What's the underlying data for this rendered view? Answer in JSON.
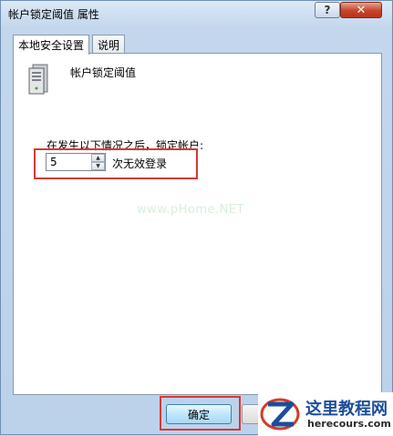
{
  "window": {
    "title": "帐户锁定阈值 属性",
    "help_label": "?",
    "close_label": "✕"
  },
  "tabs": [
    {
      "label": "本地安全设置",
      "active": true
    },
    {
      "label": "说明",
      "active": false
    }
  ],
  "policy": {
    "icon": "server-icon",
    "name": "帐户锁定阈值"
  },
  "lockout": {
    "label": "在发生以下情况之后，锁定帐户:",
    "value": "5",
    "unit_label": "次无效登录"
  },
  "watermark": "www.pHome.NET",
  "buttons": {
    "ok_label": "确定"
  },
  "site_logo": {
    "title": "这里教程网",
    "url": "herecours.com"
  },
  "colors": {
    "highlight": "#d53a35",
    "logo_blue": "#1d4d9a"
  }
}
